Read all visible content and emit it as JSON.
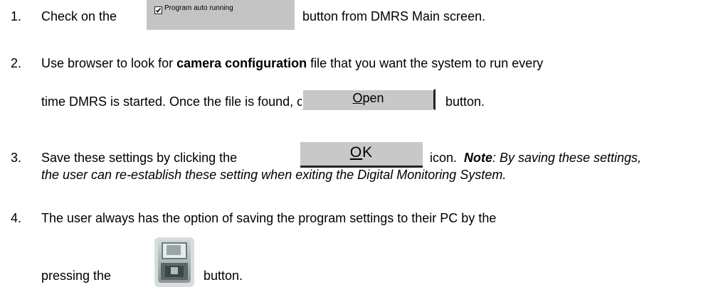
{
  "steps": [
    {
      "number": "1.",
      "text_before": "Check on the",
      "text_after": "button from DMRS Main screen."
    },
    {
      "number": "2.",
      "line1_before": "Use browser to look for",
      "line1_bold": "camera configuration",
      "line1_after": "file that you want the system to run every",
      "line2_before": "time DMRS is started. Once the file is found, click on",
      "line2_after": "button."
    },
    {
      "number": "3.",
      "text_before": "Save these settings by clicking the",
      "text_after": "icon.",
      "note_label": "Note",
      "note_text_line1": ": By saving these settings,",
      "note_text_line2": "the user can re-establish these setting when exiting the Digital Monitoring System."
    },
    {
      "number": "4.",
      "line1": "The user always has the option of saving the program settings to their PC by the",
      "line2_before": "pressing the",
      "line2_after": "button."
    }
  ],
  "buttons": {
    "auto_running": {
      "label": "Program auto running",
      "checked": true
    },
    "open": {
      "label_mnemonic": "O",
      "label_rest": "pen"
    },
    "ok": {
      "label_mnemonic": "O",
      "label_rest": "K"
    },
    "save": {
      "icon": "floppy-save-icon"
    }
  }
}
